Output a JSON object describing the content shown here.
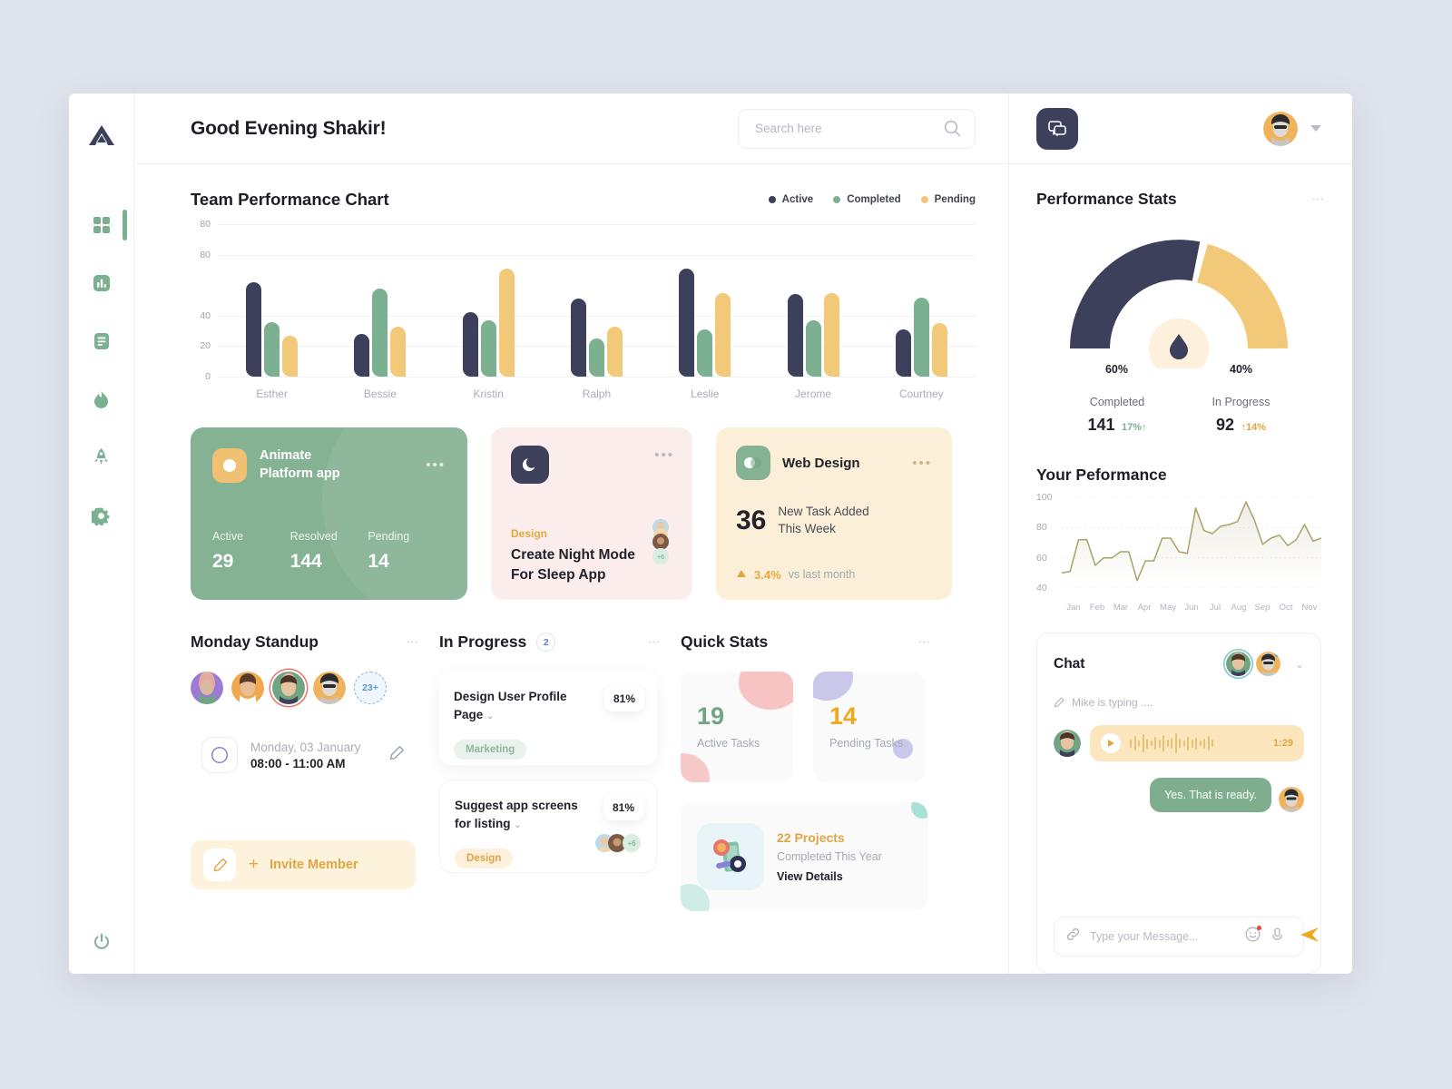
{
  "sidebar": {
    "logo_icon": "brand-logo-icon",
    "items": [
      {
        "icon": "grid-dashboard-icon",
        "name": "dashboard",
        "active": true
      },
      {
        "icon": "bar-chart-icon",
        "name": "analytics",
        "active": false
      },
      {
        "icon": "document-icon",
        "name": "documents",
        "active": false
      },
      {
        "icon": "flame-icon",
        "name": "trending",
        "active": false
      },
      {
        "icon": "rocket-icon",
        "name": "launch",
        "active": false
      },
      {
        "icon": "gear-icon",
        "name": "settings",
        "active": false
      }
    ],
    "power_icon": "power-icon"
  },
  "topbar": {
    "greeting": "Good Evening Shakir!",
    "search_placeholder": "Search here",
    "search_value": "",
    "search_icon": "search-icon"
  },
  "chart_data": {
    "type": "bar",
    "title": "Team Performance Chart",
    "xlabel": "",
    "ylabel": "",
    "ylim": [
      0,
      100
    ],
    "grid": true,
    "legend_position": "top-right",
    "ytick_labels": [
      "80",
      "80",
      "40",
      "20",
      "0"
    ],
    "ytick_positions": [
      100,
      80,
      40,
      20,
      0
    ],
    "categories": [
      "Esther",
      "Bessie",
      "Kristin",
      "Ralph",
      "Leslie",
      "Jerome",
      "Courtney"
    ],
    "series": [
      {
        "name": "Active",
        "color": "#3D405B",
        "values": [
          62,
          28,
          42,
          51,
          71,
          54,
          31
        ]
      },
      {
        "name": "Completed",
        "color": "#7BB190",
        "values": [
          36,
          58,
          37,
          25,
          31,
          37,
          52
        ]
      },
      {
        "name": "Pending",
        "color": "#F2C879",
        "values": [
          27,
          33,
          71,
          33,
          55,
          55,
          35
        ]
      }
    ]
  },
  "cards": {
    "animate": {
      "icon": "circle-dot-icon",
      "title": "Animate\nPlatform app",
      "title_line1": "Animate",
      "title_line2": "Platform app",
      "menu_icon": "ellipsis-icon",
      "stats": [
        {
          "label": "Active",
          "value": "29"
        },
        {
          "label": "Resolved",
          "value": "144"
        },
        {
          "label": "Pending",
          "value": "14"
        }
      ]
    },
    "night_mode": {
      "icon": "moon-icon",
      "menu_icon": "ellipsis-icon",
      "tag": "Design",
      "title_line1": "Create Night Mode",
      "title_line2": "For Sleep App",
      "avatar_overflow": "+6"
    },
    "web_design": {
      "icon": "toggle-icon",
      "title": "Web Design",
      "menu_icon": "ellipsis-icon",
      "number": "36",
      "subtitle_line1": "New Task Added",
      "subtitle_line2": "This Week",
      "trend_icon": "triangle-up-icon",
      "trend_value": "3.4%",
      "trend_label": "vs last month"
    }
  },
  "standup": {
    "title": "Monday Standup",
    "menu_icon": "kebab-menu-icon",
    "avatar_overflow": "23+",
    "meeting_icon": "compass-icon",
    "date": "Monday, 03 January",
    "time": "08:00 - 11:00 AM",
    "edit_icon": "pencil-icon",
    "invite_icon": "pencil-icon",
    "invite_plus": "+",
    "invite_label": "Invite Member"
  },
  "in_progress": {
    "title": "In Progress",
    "count": "2",
    "menu_icon": "kebab-menu-icon",
    "tasks": [
      {
        "title_line1": "Design User Profile",
        "title_line2": "Page",
        "chevron_icon": "chevron-down-icon",
        "percent": "81%",
        "tag": "Marketing",
        "tag_type": "marketing",
        "avatars": false,
        "avatar_overflow": ""
      },
      {
        "title_line1": "Suggest app screens",
        "title_line2": "for listing",
        "chevron_icon": "chevron-down-icon",
        "percent": "81%",
        "tag": "Design",
        "tag_type": "design",
        "avatars": true,
        "avatar_overflow": "+6"
      }
    ]
  },
  "quick_stats": {
    "title": "Quick Stats",
    "menu_icon": "kebab-menu-icon",
    "tiles": [
      {
        "value": "19",
        "label": "Active Tasks",
        "color": "#6FA583"
      },
      {
        "value": "14",
        "label": "Pending Tasks",
        "color": "#F0A81F"
      }
    ],
    "projects": {
      "thumb_icon": "projects-illustration-icon",
      "headline": "22 Projects",
      "subline": "Completed This Year",
      "link": "View Details"
    }
  },
  "right_top": {
    "message_icon": "messages-icon",
    "avatar_name": "user-avatar",
    "caret_icon": "caret-down-icon"
  },
  "performance_stats": {
    "title": "Performance Stats",
    "menu_icon": "kebab-menu-icon",
    "gauge_icon": "droplet-icon",
    "gauge": {
      "completed_pct": "60%",
      "in_progress_pct": "40%",
      "completed_value": 60,
      "in_progress_value": 40,
      "completed_color": "#3D405B",
      "in_progress_color": "#F2C879"
    },
    "stats": [
      {
        "label": "Completed",
        "value": "141",
        "delta": "17%↑",
        "delta_color": "#7BB190"
      },
      {
        "label": "In Progress",
        "value": "92",
        "delta": "↑14%",
        "delta_color": "#E0A443"
      }
    ]
  },
  "your_performance": {
    "title": "Your Peformance",
    "chart_data": {
      "type": "line",
      "title": "Your Peformance",
      "xlabel": "",
      "ylabel": "",
      "ylim": [
        40,
        100
      ],
      "grid": true,
      "line_color": "#A9A16A",
      "ytick_labels": [
        "100",
        "80",
        "60",
        "40"
      ],
      "categories": [
        "Jan",
        "Feb",
        "Mar",
        "Apr",
        "May",
        "Jun",
        "Jul",
        "Aug",
        "Sep",
        "Oct",
        "Nov"
      ],
      "values": [
        50,
        51,
        72,
        72,
        55,
        60,
        60,
        64,
        64,
        45,
        58,
        58,
        73,
        73,
        64,
        63,
        93,
        78,
        76,
        81,
        82,
        84,
        97,
        85,
        69,
        73,
        75,
        68,
        72,
        82,
        71,
        73
      ]
    }
  },
  "chat": {
    "title": "Chat",
    "chevron_icon": "chevron-down-icon",
    "typing_icon": "pencil-icon",
    "typing_text": "Mike is typing ....",
    "voice_message": {
      "play_icon": "play-icon",
      "duration": "1:29"
    },
    "outgoing_message": "Yes. That is ready.",
    "input_placeholder": "Type your Message...",
    "input_value": "",
    "attach_icon": "link-icon",
    "emoji_icon": "emoji-icon",
    "mic_icon": "microphone-icon",
    "send_icon": "send-icon"
  }
}
